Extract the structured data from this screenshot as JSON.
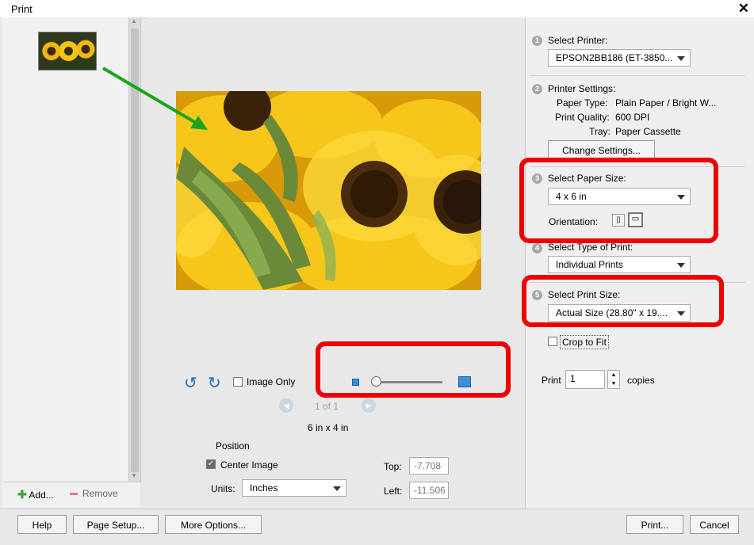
{
  "window": {
    "title": "Print",
    "close": "✕"
  },
  "left": {
    "add_label": "Add...",
    "remove_label": "Remove"
  },
  "center": {
    "image_only_label": "Image Only",
    "pager": "1 of 1",
    "image_size": "6 in x 4 in",
    "position_label": "Position",
    "center_image_label": "Center Image",
    "center_image_checked": true,
    "units_label": "Units:",
    "units_value": "Inches",
    "top_label": "Top:",
    "top_value": "-7.708",
    "left_label": "Left:",
    "left_value": "-11.506",
    "zoom_level": 0.0
  },
  "right": {
    "step1": {
      "num": "1",
      "label": "Select Printer:",
      "value": "EPSON2BB186 (ET-3850..."
    },
    "step2": {
      "num": "2",
      "label": "Printer Settings:",
      "paper_type_label": "Paper Type:",
      "paper_type": "Plain Paper / Bright W...",
      "quality_label": "Print Quality:",
      "quality": "600 DPI",
      "tray_label": "Tray:",
      "tray": "Paper Cassette",
      "change_button": "Change Settings..."
    },
    "step3": {
      "num": "3",
      "label": "Select Paper Size:",
      "value": "4 x 6 in",
      "orientation_label": "Orientation:"
    },
    "step4": {
      "num": "4",
      "label": "Select Type of Print:",
      "value": "Individual Prints"
    },
    "step5": {
      "num": "5",
      "label": "Select Print Size:",
      "value": "Actual Size (28.80\" x 19...."
    },
    "crop_label": "Crop to Fit",
    "print_label": "Print",
    "copies_value": "1",
    "copies_label": "copies"
  },
  "footer": {
    "help": "Help",
    "page_setup": "Page Setup...",
    "more_options": "More Options...",
    "print": "Print...",
    "cancel": "Cancel"
  },
  "colors": {
    "highlight": "#ee0000",
    "arrow": "#1aa51a",
    "accent_blue": "#3b8fd8"
  }
}
